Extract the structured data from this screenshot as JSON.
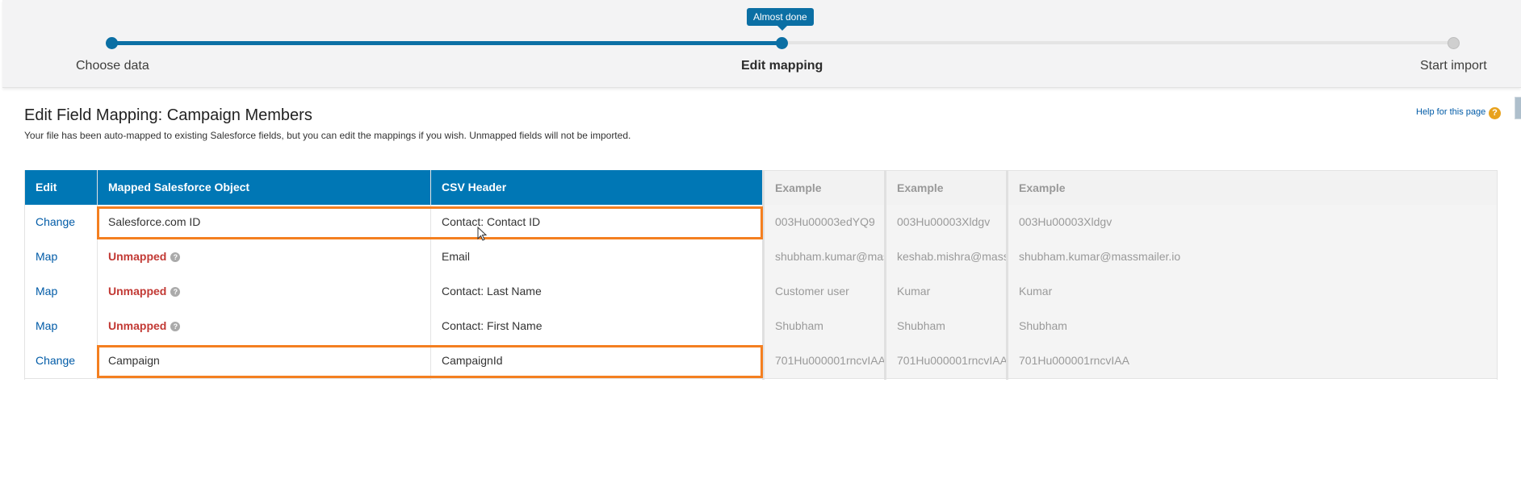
{
  "progress": {
    "tooltip": "Almost done",
    "steps": [
      {
        "label": "Choose data"
      },
      {
        "label": "Edit mapping"
      },
      {
        "label": "Start import"
      }
    ]
  },
  "page": {
    "title": "Edit Field Mapping: Campaign Members",
    "description": "Your file has been auto-mapped to existing Salesforce fields, but you can edit the mappings if you wish. Unmapped fields will not be imported.",
    "help_link": "Help for this page",
    "help_icon": "?"
  },
  "table": {
    "headers": [
      "Edit",
      "Mapped Salesforce Object",
      "CSV Header",
      "Example",
      "Example",
      "Example"
    ],
    "rows": [
      {
        "action": "Change",
        "mapped": "Salesforce.com ID",
        "unmapped": false,
        "csv": "Contact: Contact ID",
        "ex1": "003Hu00003edYQ9",
        "ex2": "003Hu00003Xldgv",
        "ex3": "003Hu00003Xldgv"
      },
      {
        "action": "Map",
        "mapped": "Unmapped",
        "unmapped": true,
        "csv": "Email",
        "ex1": "shubham.kumar@massmailer.io",
        "ex2": "keshab.mishra@massmailer.io",
        "ex3": "shubham.kumar@massmailer.io"
      },
      {
        "action": "Map",
        "mapped": "Unmapped",
        "unmapped": true,
        "csv": "Contact: Last Name",
        "ex1": "Customer user",
        "ex2": "Kumar",
        "ex3": "Kumar"
      },
      {
        "action": "Map",
        "mapped": "Unmapped",
        "unmapped": true,
        "csv": "Contact: First Name",
        "ex1": "Shubham",
        "ex2": "Shubham",
        "ex3": "Shubham"
      },
      {
        "action": "Change",
        "mapped": "Campaign",
        "unmapped": false,
        "csv": "CampaignId",
        "ex1": "701Hu000001rncvIAA",
        "ex2": "701Hu000001rncvIAA",
        "ex3": "701Hu000001rncvIAA"
      }
    ],
    "unmapped_help_icon": "?"
  },
  "colors": {
    "accent": "#0077b5",
    "progress": "#0b6fa4",
    "unmapped": "#c23934",
    "highlight": "#f47f20",
    "help_icon": "#e8a21d"
  }
}
